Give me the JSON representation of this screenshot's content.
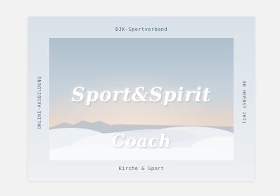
{
  "card": {
    "organization": "DJK-Sportverband",
    "footer": "Kirche & Sport",
    "side_left": "ONLINE-AUSBILDUNG",
    "side_right": "AB HERBST 2021",
    "title_line1": "Sport&Spirit",
    "title_line2": "Coach"
  },
  "colors": {
    "background": "#f2f2f2",
    "frame": "#e2e9ee",
    "sky_top": "#aebfcd",
    "sky_horizon": "#e9d6c9",
    "clouds": "#f4f6f8",
    "text_muted": "#5e6a73",
    "title": "#ffffff"
  }
}
